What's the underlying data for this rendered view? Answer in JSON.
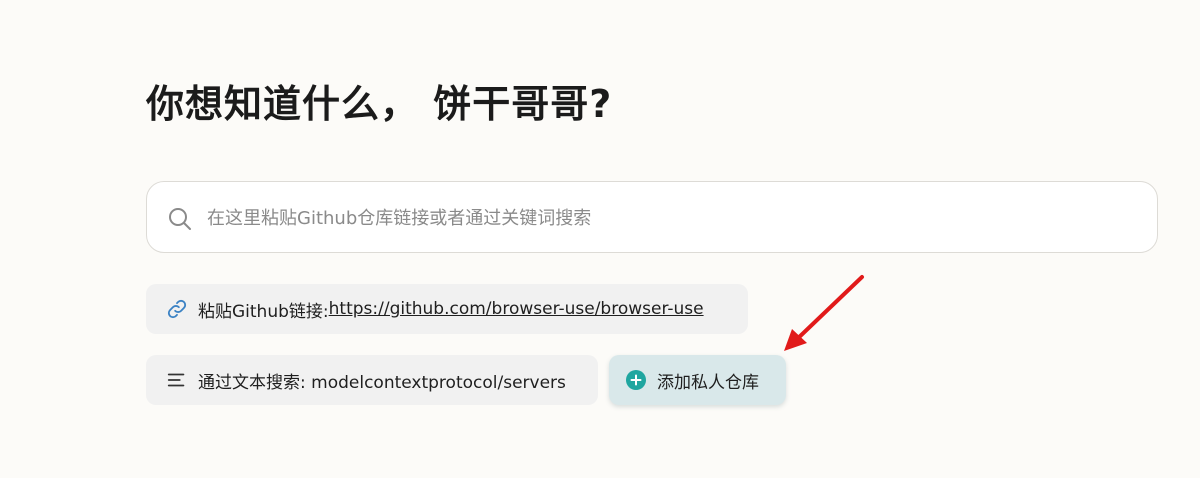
{
  "heading": "你想知道什么， 饼干哥哥?",
  "search": {
    "placeholder": "在这里粘贴Github仓库链接或者通过关键词搜索"
  },
  "suggestions": {
    "link_label": "粘贴Github链接: ",
    "link_url": "https://github.com/browser-use/browser-use",
    "text_label": "通过文本搜索: modelcontextprotocol/servers"
  },
  "add_private_repo": {
    "label": "添加私人仓库"
  },
  "colors": {
    "background": "#fcfbf8",
    "accent_teal": "#1fa6a0",
    "arrow_red": "#e11a1a",
    "link_icon_blue": "#3b82c4"
  },
  "icons": {
    "search": "search-icon",
    "link": "link-icon",
    "text_lines": "text-lines-icon",
    "plus_circle": "plus-circle-icon",
    "arrow": "red-arrow-annotation"
  }
}
